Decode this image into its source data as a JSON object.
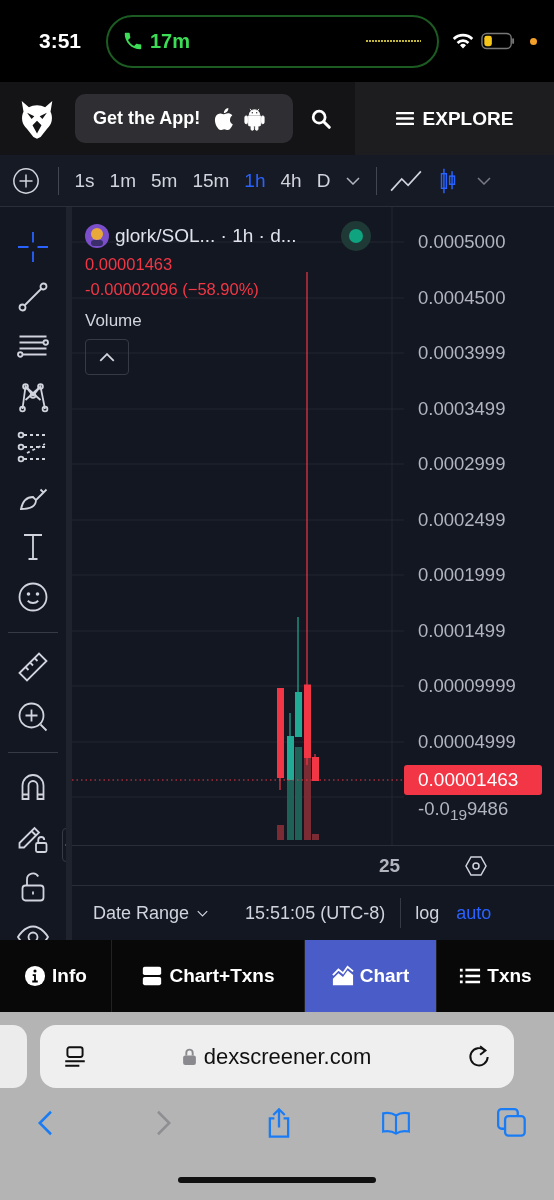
{
  "status_bar": {
    "time": "3:51",
    "call_duration": "17m"
  },
  "header": {
    "app_button": "Get the App!",
    "explore": "EXPLORE"
  },
  "intervals": [
    {
      "label": "1s",
      "selected": false
    },
    {
      "label": "1m",
      "selected": false
    },
    {
      "label": "5m",
      "selected": false
    },
    {
      "label": "15m",
      "selected": false
    },
    {
      "label": "1h",
      "selected": true
    },
    {
      "label": "4h",
      "selected": false
    },
    {
      "label": "D",
      "selected": false
    }
  ],
  "chart_types": [
    {
      "selected": false
    },
    {
      "selected": true
    }
  ],
  "drawing_tools": [
    {
      "selected": true
    },
    {
      "selected": false
    },
    {
      "selected": false
    },
    {
      "selected": false
    },
    {
      "selected": false
    },
    {
      "selected": false
    },
    {
      "selected": false
    },
    {
      "selected": false
    },
    {
      "selected": false
    },
    {
      "selected": false
    },
    {
      "selected": false
    },
    {
      "selected": false
    },
    {
      "selected": false
    },
    {
      "selected": false
    }
  ],
  "legend": {
    "pair": "glork/SOL... · 1h · d...",
    "price": "0.00001463",
    "change": "-0.00002096 (−58.90%)",
    "volume_label": "Volume"
  },
  "price_axis": [
    "0.0005000",
    "0.0004500",
    "0.0003999",
    "0.0003499",
    "0.0002999",
    "0.0002499",
    "0.0001999",
    "0.0001499",
    "0.00009999",
    "0.00004999",
    "-0.0$_{19}$9486"
  ],
  "last_price": "0.00001463",
  "time_axis": [
    "25"
  ],
  "footer": {
    "date_range": "Date Range",
    "time": "15:51:05 (UTC-8)",
    "scales": [
      {
        "label": "log",
        "on": false
      },
      {
        "label": "auto",
        "on": true
      }
    ]
  },
  "tabs": [
    {
      "label": "Info",
      "selected": false
    },
    {
      "label": "Chart+Txns",
      "selected": false
    },
    {
      "label": "Chart",
      "selected": true
    },
    {
      "label": "Txns",
      "selected": false
    }
  ],
  "browser": {
    "url": "dexscreener.com",
    "forward_disabled": true
  }
}
